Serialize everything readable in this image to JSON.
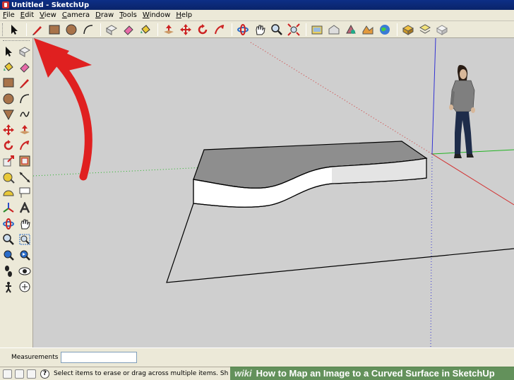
{
  "window": {
    "title": "Untitled - SketchUp"
  },
  "menu": {
    "items": [
      {
        "label": "File",
        "key": "F",
        "rest": "ile"
      },
      {
        "label": "Edit",
        "key": "E",
        "rest": "dit"
      },
      {
        "label": "View",
        "key": "V",
        "rest": "iew"
      },
      {
        "label": "Camera",
        "key": "C",
        "rest": "amera"
      },
      {
        "label": "Draw",
        "key": "D",
        "rest": "raw"
      },
      {
        "label": "Tools",
        "key": "T",
        "rest": "ools"
      },
      {
        "label": "Window",
        "key": "W",
        "rest": "indow"
      },
      {
        "label": "Help",
        "key": "H",
        "rest": "elp"
      }
    ]
  },
  "toolbar": {
    "icons": [
      "select-icon",
      "pencil-icon",
      "rectangle-icon",
      "circle-icon",
      "arc-icon",
      "make-component-icon",
      "eraser-icon",
      "paint-bucket-icon",
      "push-pull-icon",
      "move-icon",
      "rotate-icon",
      "follow-me-icon",
      "orbit-icon",
      "pan-icon",
      "zoom-icon",
      "zoom-extents-icon",
      "scene-icon",
      "warehouse-icon",
      "share-model-icon",
      "get-photo-icon",
      "google-earth-icon",
      "component-icon",
      "layer-icon",
      "style-icon"
    ]
  },
  "measurements": {
    "label": "Measurements",
    "value": ""
  },
  "status": {
    "text": "Select items to erase or drag across multiple items. Sh"
  },
  "watermark": {
    "logo": "wiki",
    "text": "How to Map an Image to a Curved Surface in SketchUp"
  },
  "colors": {
    "annotation_arrow": "#e02020",
    "axis_red": "#d23232",
    "axis_green": "#22b422",
    "axis_blue": "#3232d2",
    "face_top": "#8c8c8c",
    "face_side": "#ffffff",
    "background": "#cfcfcf"
  }
}
